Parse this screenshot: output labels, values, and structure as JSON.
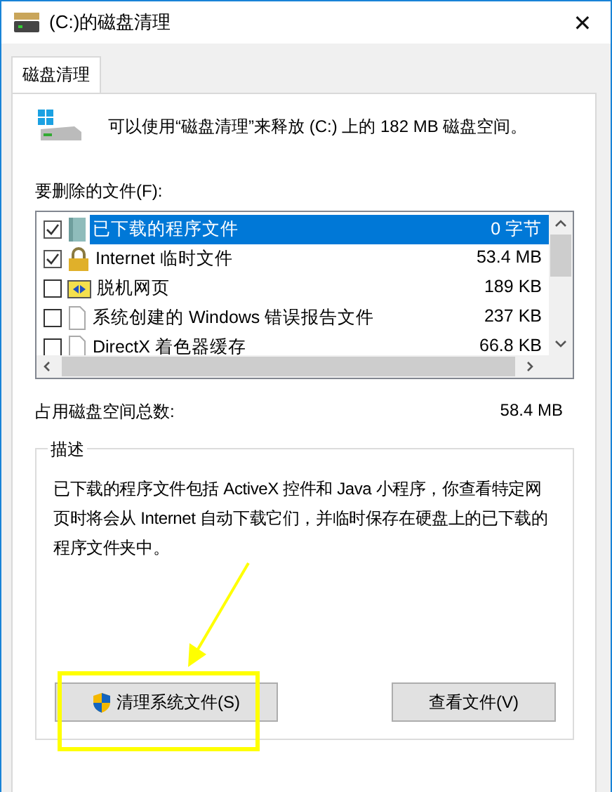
{
  "window": {
    "title": "(C:)的磁盘清理",
    "close": "✕"
  },
  "tabs": [
    {
      "label": "磁盘清理",
      "selected": true
    }
  ],
  "summary": "可以使用“磁盘清理”来释放 (C:) 上的 182 MB 磁盘空间。",
  "files_label": "要删除的文件(F):",
  "files": [
    {
      "name": "已下载的程序文件",
      "size": "0 字节",
      "checked": true,
      "selected": true,
      "kind": "program"
    },
    {
      "name": "Internet 临时文件",
      "size": "53.4 MB",
      "checked": true,
      "selected": false,
      "kind": "lock"
    },
    {
      "name": "脱机网页",
      "size": "189 KB",
      "checked": false,
      "selected": false,
      "kind": "webpage"
    },
    {
      "name": "系统创建的 Windows 错误报告文件",
      "size": "237 KB",
      "checked": false,
      "selected": false,
      "kind": "document"
    },
    {
      "name": "DirectX 着色器缓存",
      "size": "66.8 KB",
      "checked": false,
      "selected": false,
      "kind": "document"
    }
  ],
  "total": {
    "label": "占用磁盘空间总数:",
    "value": "58.4 MB"
  },
  "description": {
    "title": "描述",
    "text": "已下载的程序文件包括 ActiveX 控件和 Java 小程序，你查看特定网页时将会从 Internet 自动下载它们，并临时保存在硬盘上的已下载的程序文件夹中。"
  },
  "buttons": [
    {
      "label": "清理系统文件(S)",
      "shield": true
    },
    {
      "label": "查看文件(V)",
      "shield": false
    }
  ]
}
